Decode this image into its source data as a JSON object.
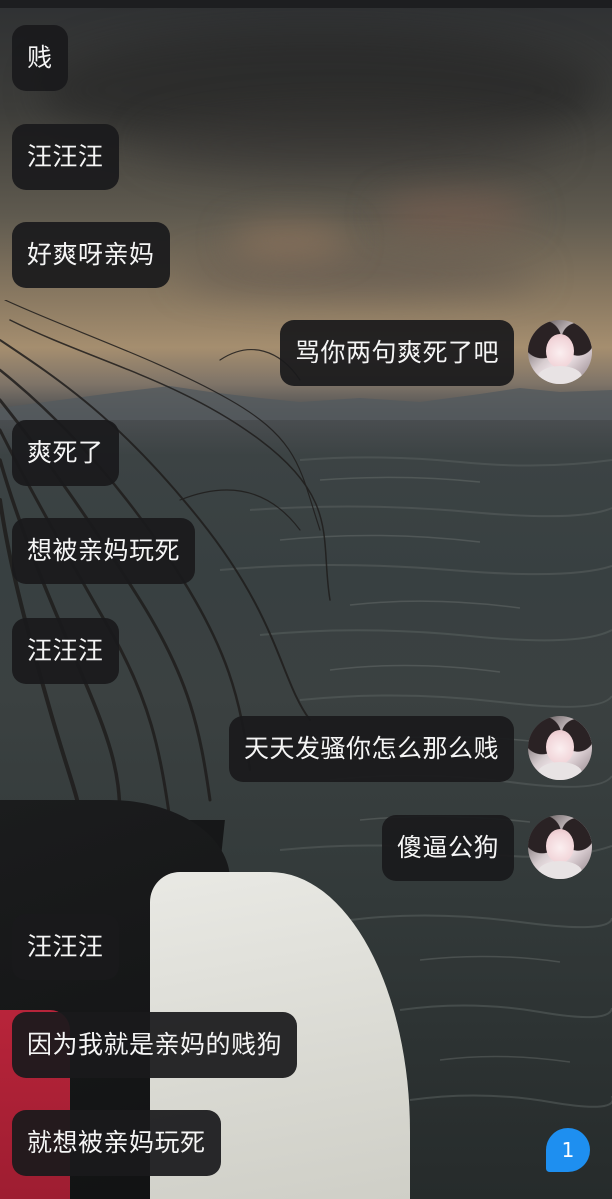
{
  "messages": [
    {
      "side": "left",
      "text": "贱"
    },
    {
      "side": "left",
      "text": "汪汪汪"
    },
    {
      "side": "left",
      "text": "好爽呀亲妈"
    },
    {
      "side": "right",
      "text": "骂你两句爽死了吧"
    },
    {
      "side": "left",
      "text": "爽死了"
    },
    {
      "side": "left",
      "text": "想被亲妈玩死"
    },
    {
      "side": "left",
      "text": "汪汪汪"
    },
    {
      "side": "right",
      "text": "天天发骚你怎么那么贱"
    },
    {
      "side": "right",
      "text": "傻逼公狗"
    },
    {
      "side": "left",
      "text": "汪汪汪"
    },
    {
      "side": "left",
      "text": "因为我就是亲妈的贱狗"
    },
    {
      "side": "left",
      "text": "就想被亲妈玩死"
    }
  ],
  "unread_badge": "1",
  "colors": {
    "bubble_bg": "#1a1a1c",
    "bubble_text": "#f5f5f5",
    "badge": "#1e8ff0"
  },
  "icons": {
    "avatar": "user-avatar"
  }
}
